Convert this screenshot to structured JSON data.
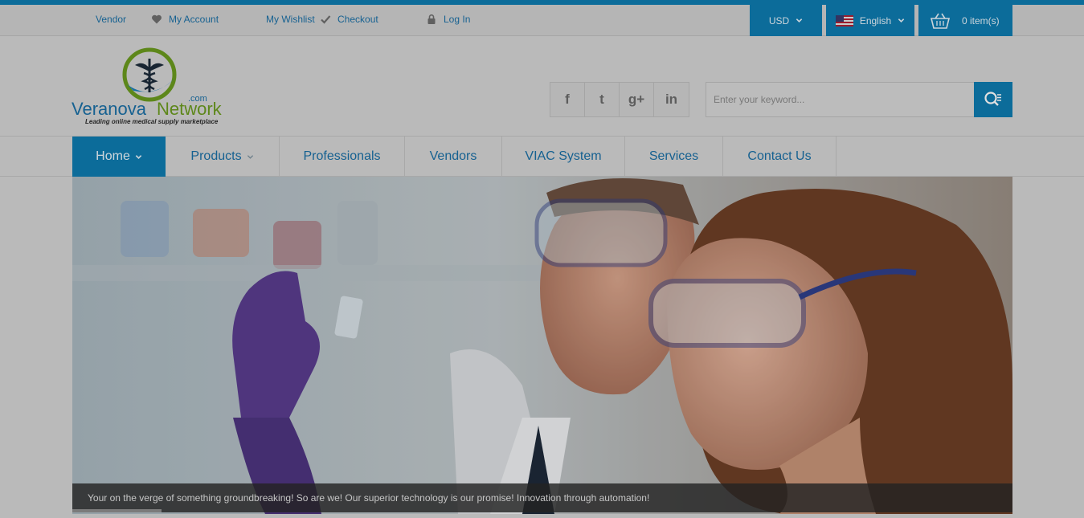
{
  "topbar": {
    "vendor": "Vendor",
    "my_account": "My Account",
    "my_wishlist": "My Wishlist",
    "checkout": "Checkout",
    "log_in": "Log In",
    "currency": "USD",
    "language": "English",
    "cart": "0 item(s)"
  },
  "logo": {
    "name_part1": "Veranova",
    "name_part2": "Network",
    "tld": ".com",
    "tagline": "Leading online medical supply marketplace"
  },
  "social": {
    "icons": [
      "facebook-icon",
      "twitter-icon",
      "google-plus-icon",
      "linkedin-icon"
    ],
    "glyphs": [
      "f",
      "t",
      "g+",
      "in"
    ]
  },
  "search": {
    "placeholder": "Enter your keyword..."
  },
  "nav": {
    "items": [
      {
        "label": "Home"
      },
      {
        "label": "Products"
      },
      {
        "label": "Professionals"
      },
      {
        "label": "Vendors"
      },
      {
        "label": "VIAC System"
      },
      {
        "label": "Services"
      },
      {
        "label": "Contact Us"
      }
    ]
  },
  "hero": {
    "caption": "Your on the verge of something groundbreaking! So are we! Our superior technology is our promise! Innovation through automation!"
  },
  "colors": {
    "accent": "#0e7bb0",
    "link": "#1a6fa5",
    "logo_green": "#6a9a1e"
  }
}
